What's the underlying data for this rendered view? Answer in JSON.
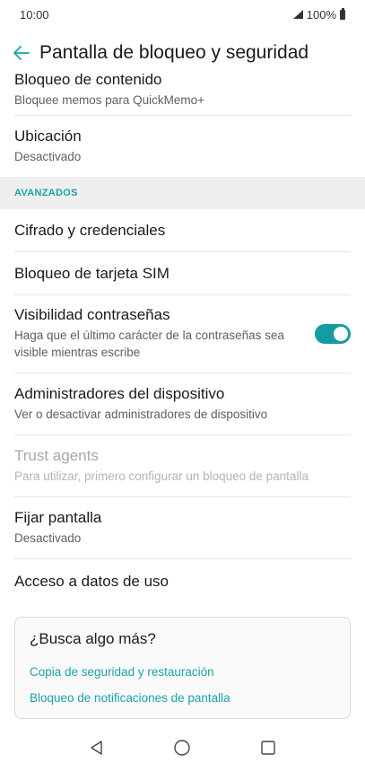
{
  "status": {
    "time": "10:00",
    "battery": "100%"
  },
  "header": {
    "title": "Pantalla de bloqueo y seguridad",
    "back_icon": "arrow-left-icon"
  },
  "clipped_item": {
    "title": "Bloqueo de contenido",
    "summary": "Bloquee memos para QuickMemo+"
  },
  "items_top": [
    {
      "title": "Ubicación",
      "summary": "Desactivado"
    }
  ],
  "section": {
    "label": "AVANZADOS"
  },
  "items": [
    {
      "title": "Cifrado y credenciales"
    },
    {
      "title": "Bloqueo de tarjeta SIM"
    },
    {
      "title": "Visibilidad contraseñas",
      "summary": "Haga que el último carácter de la contraseñas sea visible mientras escribe",
      "toggle": true
    },
    {
      "title": "Administradores del dispositivo",
      "summary": "Ver o desactivar administradores de dispositivo"
    },
    {
      "title": "Trust agents",
      "summary": "Para utilizar, primero configurar un bloqueo de pantalla",
      "disabled": true
    },
    {
      "title": "Fijar pantalla",
      "summary": "Desactivado"
    },
    {
      "title": "Acceso a datos de uso"
    }
  ],
  "card": {
    "title": "¿Busca algo más?",
    "links": [
      "Copia de seguridad y restauración",
      "Bloqueo de notificaciones de pantalla"
    ]
  },
  "colors": {
    "accent": "#1aa3a8",
    "switch_on": "#159ca3"
  }
}
